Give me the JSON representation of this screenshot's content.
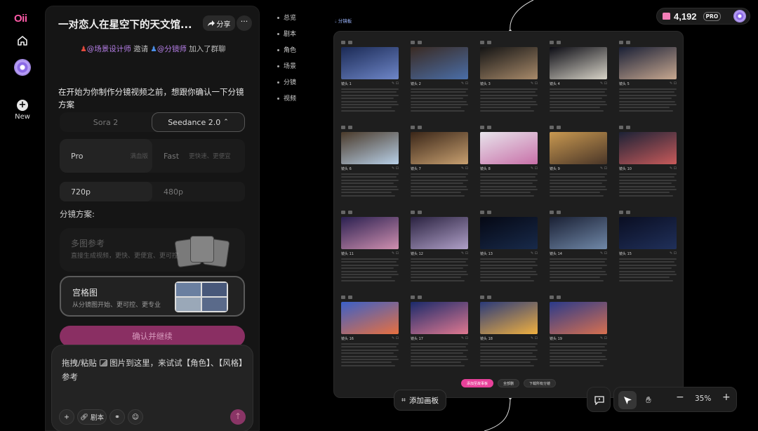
{
  "app": {
    "logo": "Oii",
    "new_label": "New"
  },
  "chat": {
    "title": "一对恋人在星空下的天文馆...",
    "share_label": "分享",
    "more_label": "···",
    "invite": {
      "inviter": "@场景设计师",
      "verb": "邀请",
      "invitee": "@分镜师",
      "suffix": "加入了群聊"
    },
    "message": "在开始为你制作分镜视频之前，想跟你确认一下分镜方案",
    "models": [
      "Sora 2",
      "Seedance 2.0"
    ],
    "model_selected": "Seedance 2.0",
    "quality": [
      {
        "name": "Pro",
        "desc": "满血版"
      },
      {
        "name": "Fast",
        "desc": "更快速、更便宜"
      }
    ],
    "resolutions": [
      "720p",
      "480p"
    ],
    "plan_label": "分镜方案:",
    "plans": [
      {
        "name": "多图参考",
        "desc": "直接生成视频，更快、更便宜、更可控"
      },
      {
        "name": "宫格图",
        "desc": "从分镜图开始、更可控、更专业"
      }
    ],
    "confirm_label": "确认并继续",
    "input_text": {
      "pre": "拖拽/粘贴",
      "post": "图片到这里，来试试【角色】、【风格】参考"
    },
    "input_buttons": {
      "add": "+",
      "script": "剧本"
    }
  },
  "outline": [
    "总览",
    "剧本",
    "角色",
    "场景",
    "分镜",
    "视频"
  ],
  "credits": {
    "value": "4,192",
    "badge": "PRO"
  },
  "board": {
    "tag": "分镜板",
    "actions": [
      "添加至故事板",
      "全部删",
      "下载所有分镜"
    ],
    "shots": [
      {
        "label": "镜头 1",
        "c1": "#1b2a55",
        "c2": "#6e86c8"
      },
      {
        "label": "镜头 2",
        "c1": "#3a2a22",
        "c2": "#4a6ea8"
      },
      {
        "label": "镜头 3",
        "c1": "#141414",
        "c2": "#a88a6a"
      },
      {
        "label": "镜头 4",
        "c1": "#0c0c14",
        "c2": "#d8d4c8"
      },
      {
        "label": "镜头 5",
        "c1": "#1a2036",
        "c2": "#c8a890"
      },
      {
        "label": "镜头 6",
        "c1": "#4a3a2a",
        "c2": "#b8d0e8"
      },
      {
        "label": "镜头 7",
        "c1": "#3a2618",
        "c2": "#c8a070"
      },
      {
        "label": "镜头 8",
        "c1": "#e8e4ec",
        "c2": "#c870a8"
      },
      {
        "label": "镜头 9",
        "c1": "#c89850",
        "c2": "#4a3628"
      },
      {
        "label": "镜头 10",
        "c1": "#1c2236",
        "c2": "#c85a5a"
      },
      {
        "label": "镜头 11",
        "c1": "#2a2050",
        "c2": "#d090b0"
      },
      {
        "label": "镜头 12",
        "c1": "#2a2240",
        "c2": "#b0a0c8"
      },
      {
        "label": "镜头 13",
        "c1": "#050814",
        "c2": "#182a4a"
      },
      {
        "label": "镜头 14",
        "c1": "#1a2034",
        "c2": "#7088a8"
      },
      {
        "label": "镜头 15",
        "c1": "#0a0e22",
        "c2": "#20305a"
      },
      {
        "label": "镜头 16",
        "c1": "#3a60c8",
        "c2": "#e87040"
      },
      {
        "label": "镜头 17",
        "c1": "#1a2a6a",
        "c2": "#e07890"
      },
      {
        "label": "镜头 18",
        "c1": "#2a3a7a",
        "c2": "#f0b040"
      },
      {
        "label": "镜头 19",
        "c1": "#2a3a8a",
        "c2": "#d87050"
      }
    ]
  },
  "toolbar": {
    "add_board": "添加画板",
    "zoom": "35%",
    "zoom_out": "−",
    "zoom_in": "+"
  },
  "colors": {
    "accent": "#e7419a",
    "purple": "#8c6ae6"
  }
}
